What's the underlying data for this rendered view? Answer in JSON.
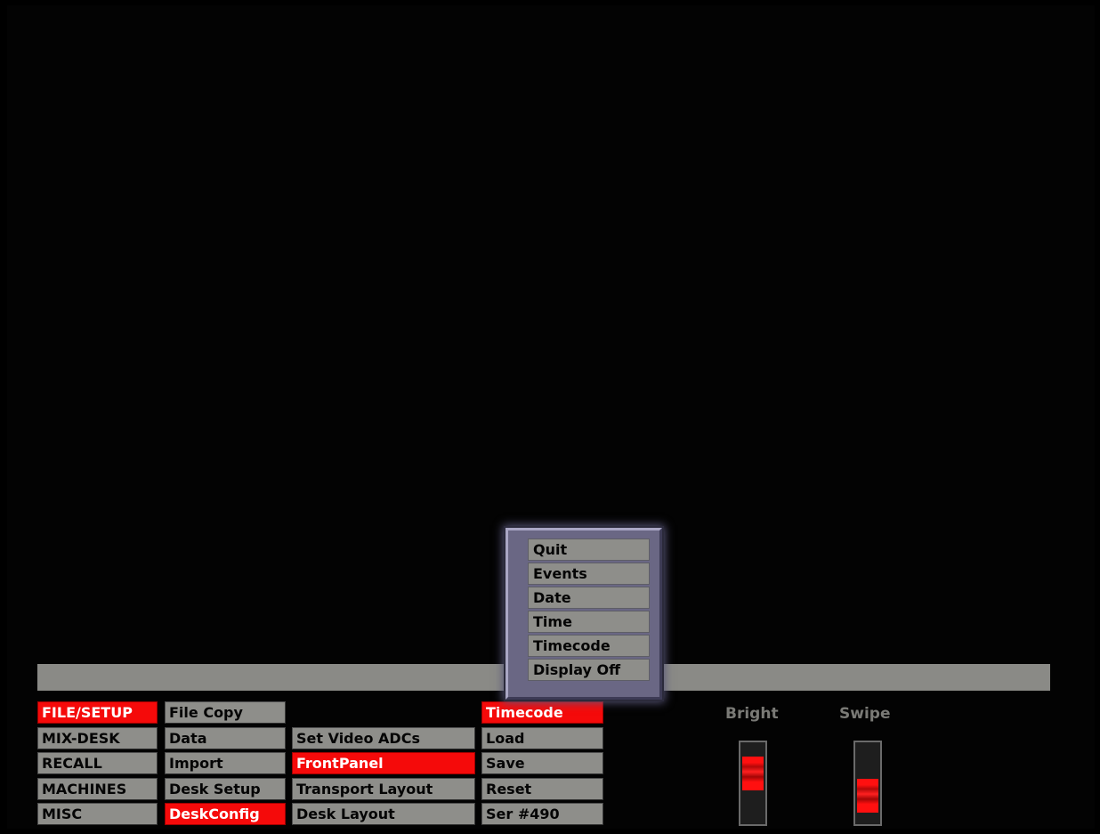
{
  "menu": {
    "col1": [
      {
        "label": "FILE/SETUP",
        "selected": true
      },
      {
        "label": "MIX-DESK",
        "selected": false
      },
      {
        "label": "RECALL",
        "selected": false
      },
      {
        "label": "MACHINES",
        "selected": false
      },
      {
        "label": "MISC",
        "selected": false
      }
    ],
    "col2": [
      {
        "label": "File  Copy",
        "selected": false
      },
      {
        "label": "Data",
        "selected": false
      },
      {
        "label": "Import",
        "selected": false
      },
      {
        "label": "Desk  Setup",
        "selected": false
      },
      {
        "label": "DeskConfig",
        "selected": true
      }
    ],
    "col3": [
      {
        "label": "Set  Video  ADCs",
        "selected": false
      },
      {
        "label": "FrontPanel",
        "selected": true
      },
      {
        "label": "Transport  Layout",
        "selected": false
      },
      {
        "label": "Desk  Layout",
        "selected": false
      }
    ],
    "col4": [
      {
        "label": "Timecode",
        "selected": true
      },
      {
        "label": "Load",
        "selected": false
      },
      {
        "label": "Save",
        "selected": false
      },
      {
        "label": "Reset",
        "selected": false
      },
      {
        "label": "Ser  #490",
        "selected": false
      }
    ]
  },
  "popup": {
    "items": [
      "Quit",
      "Events",
      "Date",
      "Time",
      "Timecode",
      "Display  Off"
    ]
  },
  "sliders": {
    "bright": {
      "label": "Bright",
      "level": 0.7
    },
    "swipe": {
      "label": "Swipe",
      "level": 0.25
    }
  },
  "colors": {
    "selected": "#f50a0a",
    "button": "#8e8e8a",
    "popup_frame": "#6a6784",
    "background": "#030303"
  }
}
